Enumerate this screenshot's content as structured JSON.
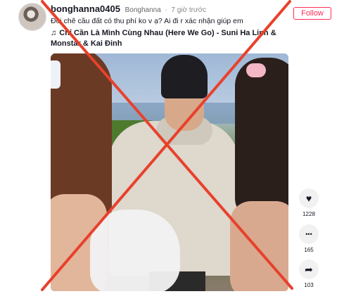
{
  "post": {
    "username": "bonghanna0405",
    "nickname": "Bonghanna",
    "separator": "·",
    "time": "7 giờ trước",
    "follow_label": "Follow",
    "caption": "Đôi chê cầu đất có thu phí ko v ạ? Ai đi r xác nhận giúp em",
    "music_icon": "♫",
    "music": "Chỉ Cần Là Mình Cùng Nhau (Here We Go) - Suni Ha Linh & Monstar & Kai Đinh"
  },
  "actions": {
    "like": {
      "icon": "heart-icon",
      "glyph": "♥",
      "count": "1228"
    },
    "comment": {
      "icon": "comment-icon",
      "glyph": "•••",
      "count": "165"
    },
    "share": {
      "icon": "share-icon",
      "glyph": "➦",
      "count": "103"
    }
  },
  "colors": {
    "follow_accent": "#fe2c55",
    "cross_mark": "#e8412c"
  }
}
